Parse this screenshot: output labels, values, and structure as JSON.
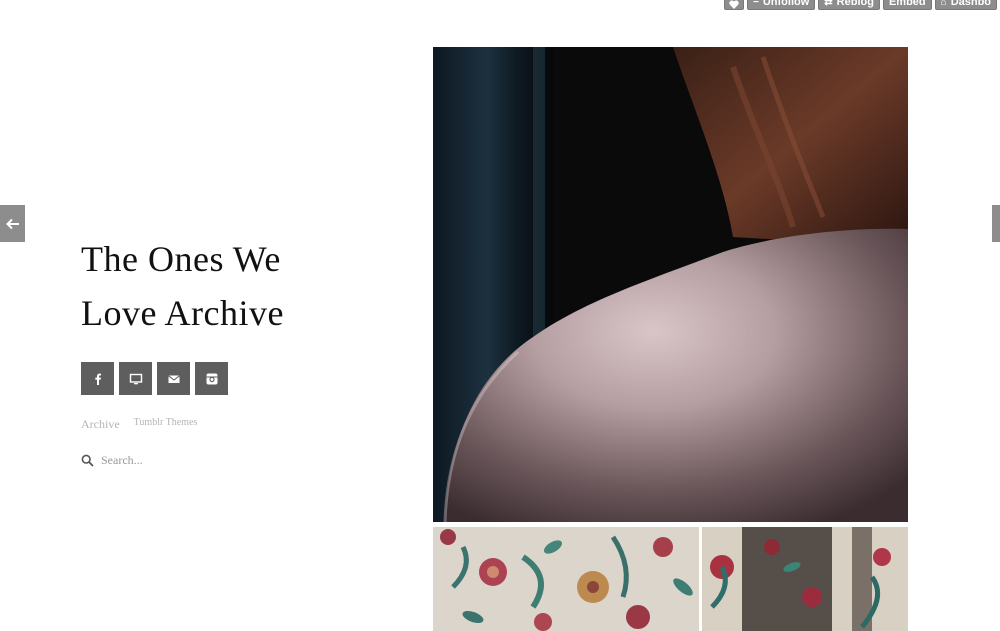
{
  "tumblr_controls": {
    "unfollow": "Unfollow",
    "reblog": "Reblog",
    "embed": "Embed",
    "dashboard": "Dashbo"
  },
  "blog": {
    "title_line1": "The Ones We",
    "title_line2": "Love Archive"
  },
  "social_icons": [
    "facebook-icon",
    "monitor-icon",
    "mail-icon",
    "instagram-icon"
  ],
  "links": {
    "archive": "Archive",
    "themes": "Tumblr Themes"
  },
  "search": {
    "placeholder": "Search..."
  },
  "colors": {
    "control_gray": "#8d8d8d",
    "social_gray": "#5e5e5e",
    "link_gray": "#b5b5b5"
  }
}
